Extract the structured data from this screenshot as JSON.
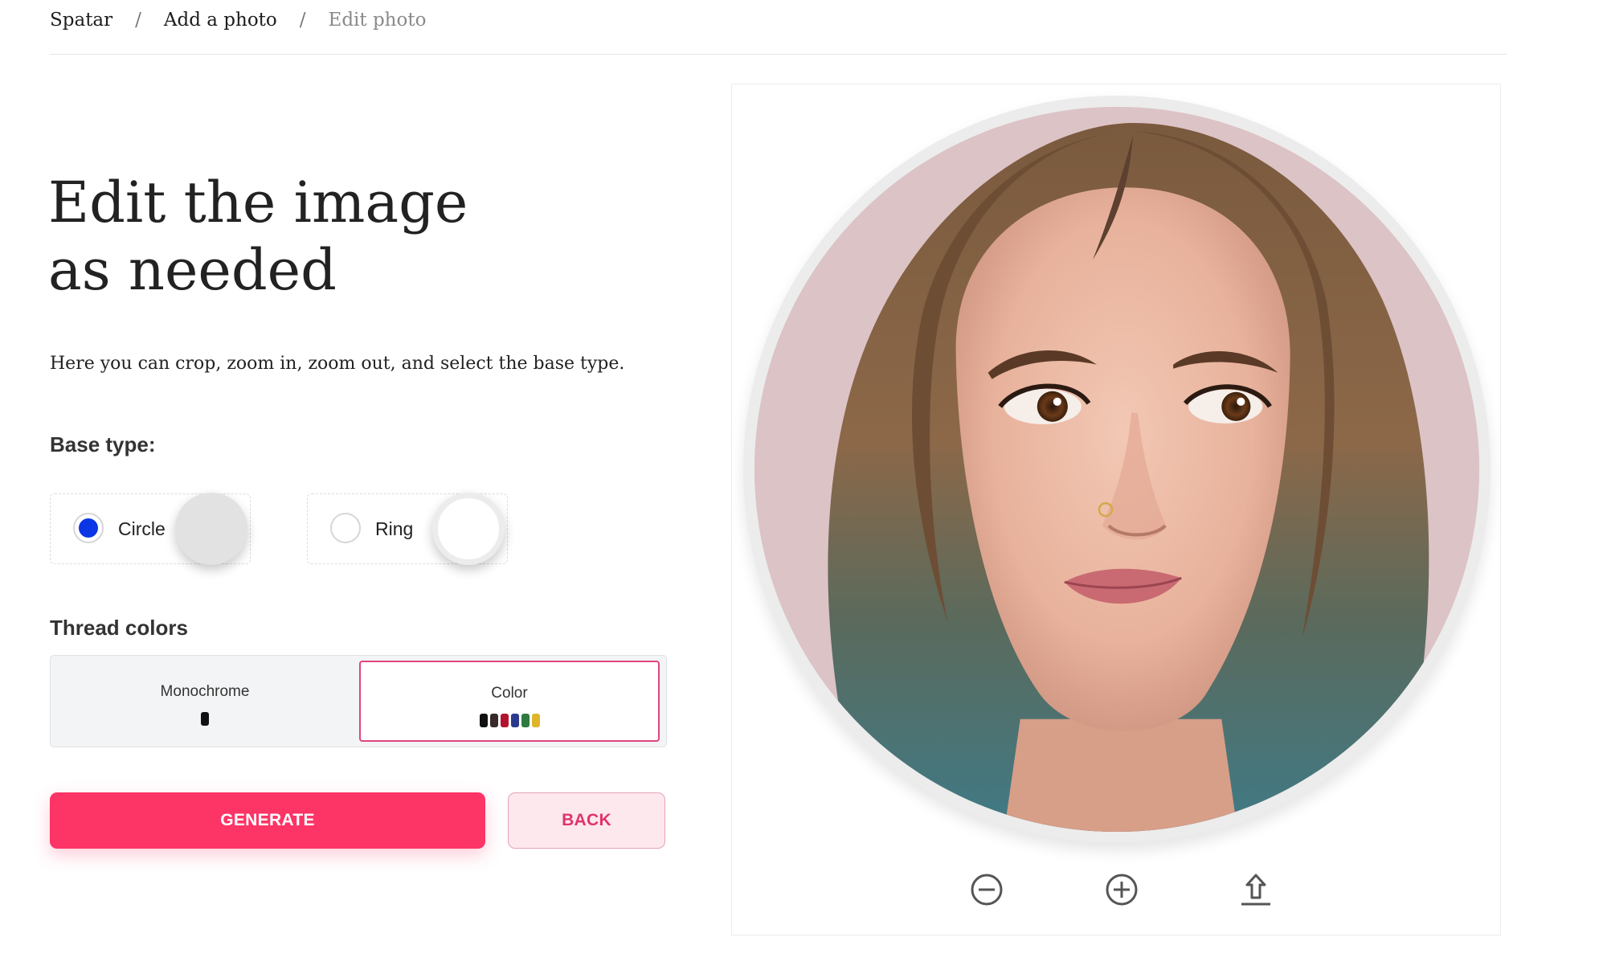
{
  "breadcrumb": {
    "items": [
      {
        "label": "Spatar"
      },
      {
        "label": "Add a photo"
      },
      {
        "label": "Edit photo"
      }
    ],
    "separator": "/"
  },
  "page": {
    "title": "Edit the image as needed",
    "description": "Here you can crop, zoom in, zoom out, and select the base type."
  },
  "base_type": {
    "label": "Base type:",
    "options": [
      {
        "label": "Circle",
        "selected": true
      },
      {
        "label": "Ring",
        "selected": false
      }
    ]
  },
  "thread_colors": {
    "label": "Thread colors",
    "options": [
      {
        "label": "Monochrome",
        "selected": false,
        "swatches": [
          "#111111"
        ]
      },
      {
        "label": "Color",
        "selected": true,
        "swatches": [
          "#111111",
          "#3a2a2a",
          "#b3132f",
          "#2a3a8c",
          "#2f7a3f",
          "#e0b52a"
        ]
      }
    ]
  },
  "buttons": {
    "generate": "GENERATE",
    "back": "BACK"
  },
  "preview": {
    "image": "portrait-photo",
    "tools": [
      {
        "name": "zoom-out-icon"
      },
      {
        "name": "zoom-in-icon"
      },
      {
        "name": "upload-icon"
      }
    ]
  },
  "colors": {
    "accent": "#fd3466",
    "accent_light": "#fde8ee",
    "radio_selected": "#0a36e6",
    "selected_border": "#e0457c"
  }
}
